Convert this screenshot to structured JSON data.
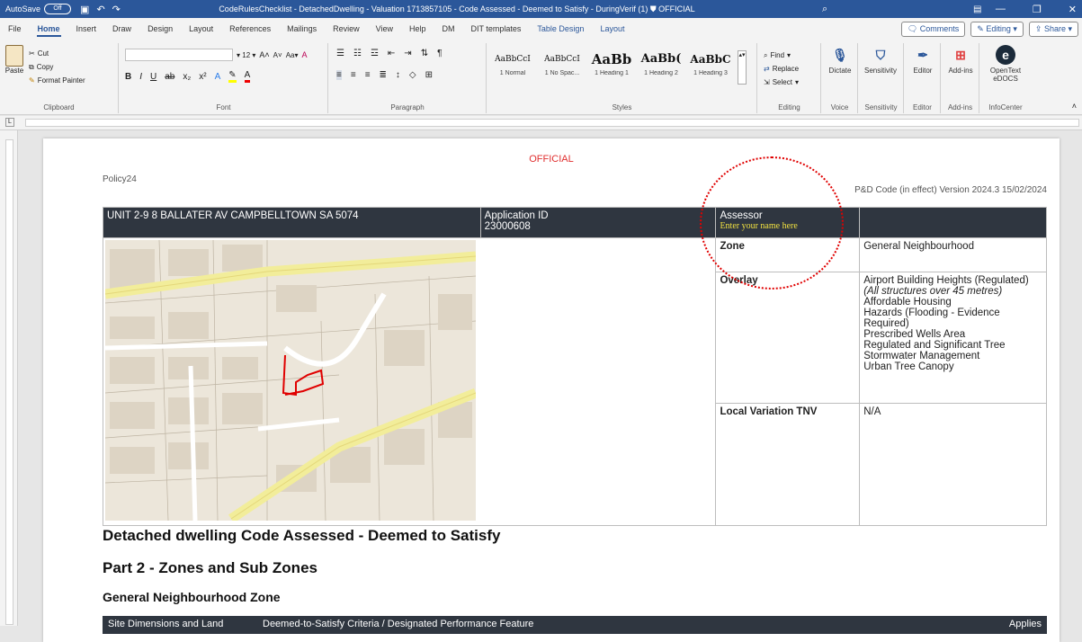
{
  "titlebar": {
    "autosave_label": "AutoSave",
    "autosave_state": "Off",
    "title": "CodeRulesChecklist - DetachedDwelling - Valuation 1713857105 - Code Assessed - Deemed to Satisfy - DuringVerif (1)",
    "sensitivity": "OFFICIAL"
  },
  "tabs": [
    "File",
    "Home",
    "Insert",
    "Draw",
    "Design",
    "Layout",
    "References",
    "Mailings",
    "Review",
    "View",
    "Help",
    "DM",
    "DIT templates",
    "Table Design",
    "Layout"
  ],
  "tab_active_index": 1,
  "tab_actions": {
    "comments": "Comments",
    "editing": "Editing",
    "share": "Share"
  },
  "ribbon": {
    "clipboard": {
      "paste": "Paste",
      "cut": "Cut",
      "copy": "Copy",
      "format_painter": "Format Painter",
      "label": "Clipboard"
    },
    "font": {
      "size": "12",
      "label": "Font"
    },
    "paragraph": {
      "label": "Paragraph"
    },
    "styles": {
      "label": "Styles",
      "items": [
        {
          "sample": "AaBbCcI",
          "name": "1 Normal"
        },
        {
          "sample": "AaBbCcI",
          "name": "1 No Spac..."
        },
        {
          "sample": "AaBb",
          "name": "1 Heading 1"
        },
        {
          "sample": "AaBb(",
          "name": "1 Heading 2"
        },
        {
          "sample": "AaBbC",
          "name": "1 Heading 3"
        }
      ]
    },
    "editing": {
      "find": "Find",
      "replace": "Replace",
      "select": "Select",
      "label": "Editing"
    },
    "voice": {
      "dictate": "Dictate",
      "label": "Voice"
    },
    "sensitivity": {
      "button": "Sensitivity",
      "label": "Sensitivity"
    },
    "editor": {
      "button": "Editor",
      "label": "Editor"
    },
    "addins": {
      "button": "Add-ins",
      "label": "Add-ins"
    },
    "infocenter": {
      "button": "OpenText eDOCS",
      "label": "InfoCenter"
    }
  },
  "document": {
    "official": "OFFICIAL",
    "policy": "Policy24",
    "version": "P&D Code (in effect) Version 2024.3 15/02/2024",
    "address": "UNIT 2-9 8 BALLATER AV CAMPBELLTOWN SA 5074",
    "application_label": "Application ID",
    "application_id": "23000608",
    "assessor_label": "Assessor",
    "assessor_placeholder": "Enter your name here",
    "zone_label": "Zone",
    "zone_value": "General Neighbourhood",
    "overlay_label": "Overlay",
    "overlays": [
      "Airport Building Heights (Regulated)",
      "(All structures over 45 metres)",
      "Affordable Housing",
      "Hazards (Flooding - Evidence Required)",
      "Prescribed Wells Area",
      "Regulated and Significant Tree",
      "Stormwater Management",
      "Urban Tree Canopy"
    ],
    "local_variation_label": "Local Variation TNV",
    "local_variation_value": "N/A",
    "heading1": "Detached dwelling Code Assessed - Deemed to Satisfy",
    "heading2": "Part 2 - Zones and Sub Zones",
    "heading3": "General Neighbourhood Zone",
    "table_cols": [
      "Site Dimensions and Land",
      "Deemed-to-Satisfy Criteria / Designated Performance Feature",
      "Applies"
    ]
  },
  "colors": {
    "titlebar": "#2b579a",
    "header_row": "#2f3640",
    "official": "#e03030",
    "assessor_input": "#f0e040",
    "annotation_circle": "#e00000",
    "parcel_outline": "#e00000"
  }
}
